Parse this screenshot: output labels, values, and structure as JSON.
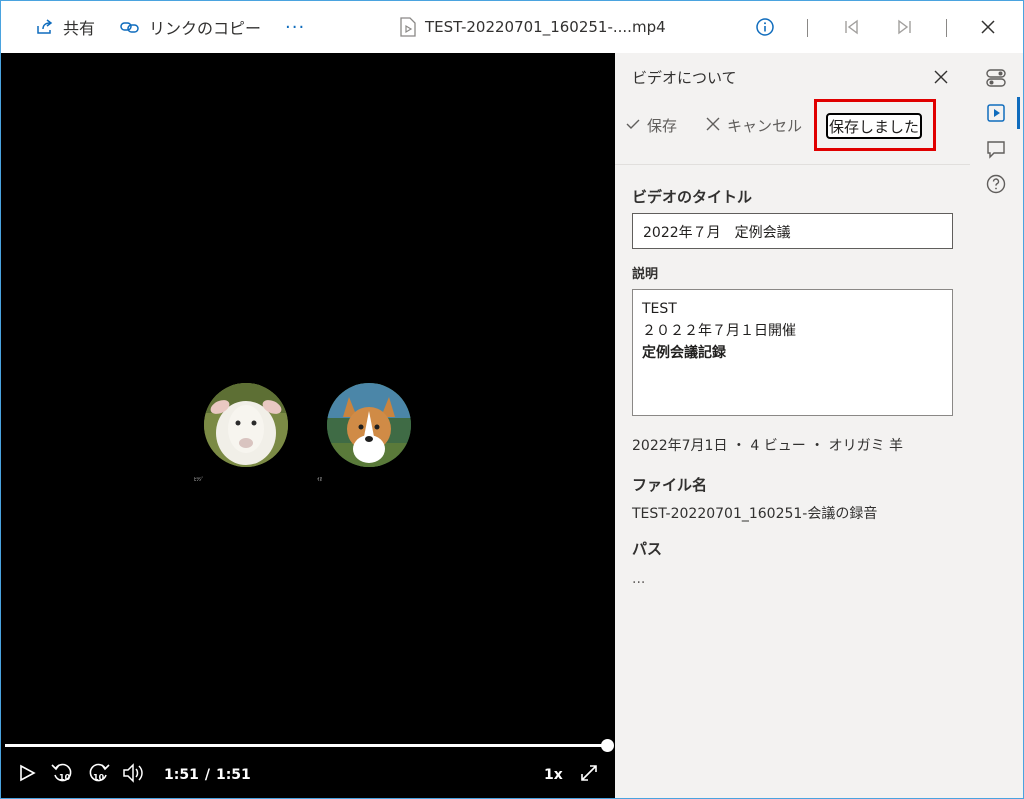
{
  "toolbar": {
    "share_label": "共有",
    "copy_link_label": "リンクのコピー",
    "more_label": "···",
    "file_name": "TEST-20220701_160251-....mp4"
  },
  "video": {
    "participants": [
      {
        "name": "ﾋﾂｼﾞ",
        "icon": "sheep-avatar"
      },
      {
        "name": "ｲﾇ",
        "icon": "dog-avatar"
      }
    ],
    "progress_fraction": 1.0,
    "current_time": "1:51",
    "separator": "/",
    "duration": "1:51",
    "speed": "1x"
  },
  "panel": {
    "title": "ビデオについて",
    "save_label": "保存",
    "cancel_label": "キャンセル",
    "saved_label": "保存しました",
    "video_title_label": "ビデオのタイトル",
    "video_title_value": "2022年７月　定例会議",
    "description_label": "説明",
    "description_lines": [
      "TEST",
      "２０２２年７月１日開催",
      "定例会議記録"
    ],
    "meta": "2022年7月1日 ・ 4 ビュー ・ オリガミ 羊",
    "file_name_label": "ファイル名",
    "file_name_value": "TEST-20220701_160251-会議の録音",
    "path_label": "パス",
    "path_value": "..."
  },
  "colors": {
    "accent": "#0f6cbd",
    "highlight": "#e00000",
    "panel_bg": "#f3f2f1",
    "video_bg": "#000000"
  }
}
